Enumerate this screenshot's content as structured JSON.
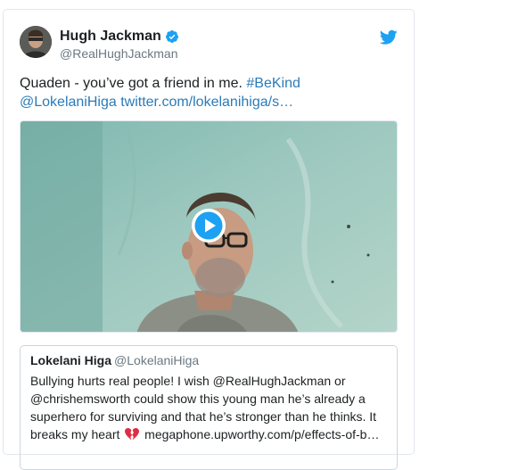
{
  "author": {
    "display_name": "Hugh Jackman",
    "handle": "@RealHughJackman",
    "verified": true
  },
  "tweet": {
    "text": "Quaden - you’ve got a friend in me. ",
    "hashtag": "#BeKind",
    "mention": "@LokelaniHiga",
    "link": "twitter.com/lokelanihiga/s…"
  },
  "media": {
    "type": "video",
    "play_icon": "play-circle-icon"
  },
  "quoted_tweet": {
    "display_name": "Lokelani Higa",
    "handle": "@LokelaniHiga",
    "text_before": "Bullying hurts real people! I wish @RealHughJackman or @chrishemsworth could show this young man he’s already a superhero for surviving and that he’s stronger than he thinks. It breaks my heart",
    "emoji": "broken-heart-icon",
    "link": "megaphone.upworthy.com/p/effects-of-b…"
  },
  "colors": {
    "link": "#2b7bb9",
    "verified": "#1da1f2",
    "bird": "#1da1f2",
    "handle": "#697882"
  }
}
